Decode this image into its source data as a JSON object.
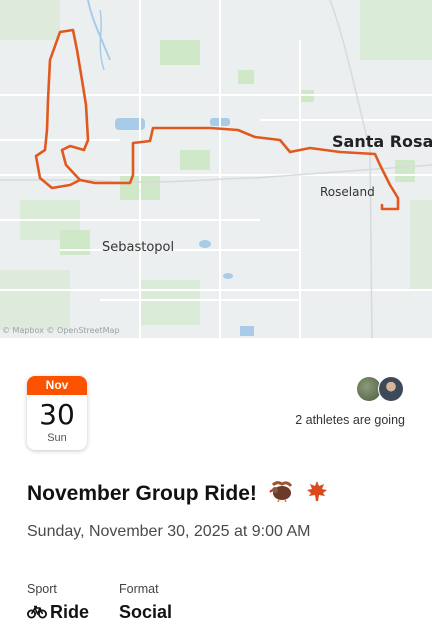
{
  "map": {
    "places": {
      "santa_rosa": "Santa Rosa",
      "roseland": "Roseland",
      "sebastopol": "Sebastopol"
    },
    "attribution": "© Mapbox © OpenStreetMap",
    "route_color": "#e2591f"
  },
  "event": {
    "date": {
      "month": "Nov",
      "day": "30",
      "weekday": "Sun"
    },
    "attendees_text": "2 athletes are going",
    "title": "November Group Ride!",
    "title_emojis": [
      "turkey-icon",
      "maple-leaf-icon"
    ],
    "datetime": "Sunday, November 30, 2025 at 9:00 AM",
    "sport_label": "Sport",
    "sport_value": "Ride",
    "sport_icon": "bike-icon",
    "format_label": "Format",
    "format_value": "Social"
  },
  "colors": {
    "accent": "#fc5200"
  }
}
